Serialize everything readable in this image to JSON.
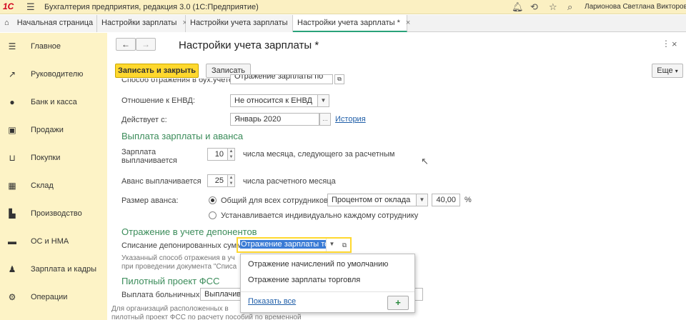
{
  "app": {
    "logo_text": "1С",
    "title": "Бухгалтерия предприятия, редакция 3.0  (1С:Предприятие)",
    "user_name": "Ларионова Светлана Викторовна",
    "colors": {
      "accent": "#ffd82e",
      "section": "#3b8c5a",
      "sidebar": "#fdf3c6",
      "link": "#1f5ea8"
    }
  },
  "tabs": [
    {
      "label": "Начальная страница",
      "icon": "home-icon"
    },
    {
      "label": "Настройки зарплаты"
    },
    {
      "label": "Настройки учета зарплаты"
    },
    {
      "label": "Настройки учета зарплаты *"
    }
  ],
  "sidebar": {
    "items": [
      {
        "label": "Главное",
        "icon": "menu-lines-icon"
      },
      {
        "label": "Руководителю",
        "icon": "trend-icon"
      },
      {
        "label": "Банк и касса",
        "icon": "coin-icon"
      },
      {
        "label": "Продажи",
        "icon": "bag-icon"
      },
      {
        "label": "Покупки",
        "icon": "cart-icon"
      },
      {
        "label": "Склад",
        "icon": "grid-icon"
      },
      {
        "label": "Производство",
        "icon": "factory-icon"
      },
      {
        "label": "ОС и НМА",
        "icon": "truck-icon"
      },
      {
        "label": "Зарплата и кадры",
        "icon": "person-icon"
      },
      {
        "label": "Операции",
        "icon": "ops-icon"
      }
    ]
  },
  "form": {
    "title": "Настройки учета зарплаты *",
    "save_close_label": "Записать и закрыть",
    "save_label": "Записать",
    "more_label": "Еще",
    "accounting_method_label": "Способ отражения в бух.учете:",
    "accounting_method_value": "Отражение зарплаты по",
    "envd_label": "Отношение к ЕНВД:",
    "envd_value": "Не относится к ЕНВД",
    "effective_label": "Действует с:",
    "effective_value": "Январь 2020",
    "history_link": "История",
    "payout_section": "Выплата зарплаты и аванса",
    "salary_label_1": "Зарплата",
    "salary_label_2": "выплачивается",
    "salary_day": "10",
    "salary_suffix": "числа месяца, следующего за расчетным",
    "advance_label": "Аванс выплачивается",
    "advance_day": "25",
    "advance_suffix": "числа расчетного месяца",
    "advance_size_label": "Размер аванса:",
    "radio_common": "Общий для всех сотрудников",
    "advance_mode": "Процентом от оклада",
    "advance_percent": "40,00",
    "percent_sign": "%",
    "radio_individual": "Устанавливается индивидуально каждому сотруднику",
    "deponent_section": "Отражение в учете депонентов",
    "deponent_label": "Списание депонированных сумм:",
    "deponent_value": "Отражение зарплаты то",
    "deponent_note_1": "Указанный способ отражения в уч",
    "deponent_note_2": "при проведении документа \"Списа",
    "fss_section": "Пилотный проект ФСС",
    "sick_label": "Выплата больничных:",
    "sick_value": "Выплачивается",
    "fss_note_1": "Для организаций расположенных в",
    "fss_note_2": "пилотный проект ФСС по расчету пособий по временной"
  },
  "dropdown": {
    "items": [
      "Отражение начислений по умолчанию",
      "Отражение зарплаты торговля"
    ],
    "show_all": "Показать все",
    "add_symbol": "+"
  }
}
